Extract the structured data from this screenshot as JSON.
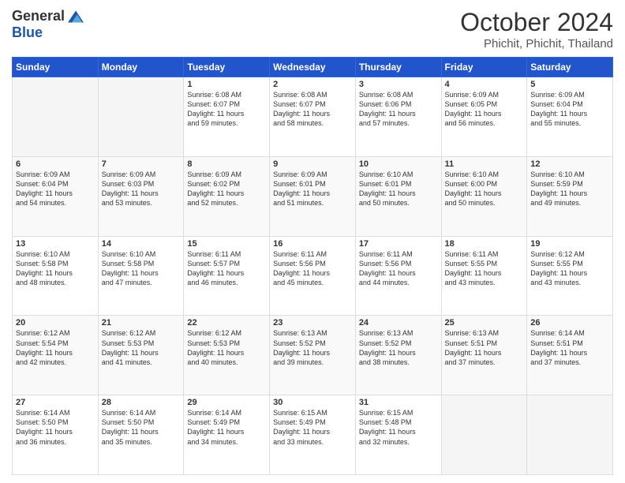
{
  "logo": {
    "general": "General",
    "blue": "Blue"
  },
  "title": "October 2024",
  "location": "Phichit, Phichit, Thailand",
  "days_of_week": [
    "Sunday",
    "Monday",
    "Tuesday",
    "Wednesday",
    "Thursday",
    "Friday",
    "Saturday"
  ],
  "weeks": [
    [
      {
        "day": "",
        "content": ""
      },
      {
        "day": "",
        "content": ""
      },
      {
        "day": "1",
        "sunrise": "6:08 AM",
        "sunset": "6:07 PM",
        "daylight": "11 hours and 59 minutes."
      },
      {
        "day": "2",
        "sunrise": "6:08 AM",
        "sunset": "6:07 PM",
        "daylight": "11 hours and 58 minutes."
      },
      {
        "day": "3",
        "sunrise": "6:08 AM",
        "sunset": "6:06 PM",
        "daylight": "11 hours and 57 minutes."
      },
      {
        "day": "4",
        "sunrise": "6:09 AM",
        "sunset": "6:05 PM",
        "daylight": "11 hours and 56 minutes."
      },
      {
        "day": "5",
        "sunrise": "6:09 AM",
        "sunset": "6:04 PM",
        "daylight": "11 hours and 55 minutes."
      }
    ],
    [
      {
        "day": "6",
        "sunrise": "6:09 AM",
        "sunset": "6:04 PM",
        "daylight": "11 hours and 54 minutes."
      },
      {
        "day": "7",
        "sunrise": "6:09 AM",
        "sunset": "6:03 PM",
        "daylight": "11 hours and 53 minutes."
      },
      {
        "day": "8",
        "sunrise": "6:09 AM",
        "sunset": "6:02 PM",
        "daylight": "11 hours and 52 minutes."
      },
      {
        "day": "9",
        "sunrise": "6:09 AM",
        "sunset": "6:01 PM",
        "daylight": "11 hours and 51 minutes."
      },
      {
        "day": "10",
        "sunrise": "6:10 AM",
        "sunset": "6:01 PM",
        "daylight": "11 hours and 50 minutes."
      },
      {
        "day": "11",
        "sunrise": "6:10 AM",
        "sunset": "6:00 PM",
        "daylight": "11 hours and 50 minutes."
      },
      {
        "day": "12",
        "sunrise": "6:10 AM",
        "sunset": "5:59 PM",
        "daylight": "11 hours and 49 minutes."
      }
    ],
    [
      {
        "day": "13",
        "sunrise": "6:10 AM",
        "sunset": "5:58 PM",
        "daylight": "11 hours and 48 minutes."
      },
      {
        "day": "14",
        "sunrise": "6:10 AM",
        "sunset": "5:58 PM",
        "daylight": "11 hours and 47 minutes."
      },
      {
        "day": "15",
        "sunrise": "6:11 AM",
        "sunset": "5:57 PM",
        "daylight": "11 hours and 46 minutes."
      },
      {
        "day": "16",
        "sunrise": "6:11 AM",
        "sunset": "5:56 PM",
        "daylight": "11 hours and 45 minutes."
      },
      {
        "day": "17",
        "sunrise": "6:11 AM",
        "sunset": "5:56 PM",
        "daylight": "11 hours and 44 minutes."
      },
      {
        "day": "18",
        "sunrise": "6:11 AM",
        "sunset": "5:55 PM",
        "daylight": "11 hours and 43 minutes."
      },
      {
        "day": "19",
        "sunrise": "6:12 AM",
        "sunset": "5:55 PM",
        "daylight": "11 hours and 43 minutes."
      }
    ],
    [
      {
        "day": "20",
        "sunrise": "6:12 AM",
        "sunset": "5:54 PM",
        "daylight": "11 hours and 42 minutes."
      },
      {
        "day": "21",
        "sunrise": "6:12 AM",
        "sunset": "5:53 PM",
        "daylight": "11 hours and 41 minutes."
      },
      {
        "day": "22",
        "sunrise": "6:12 AM",
        "sunset": "5:53 PM",
        "daylight": "11 hours and 40 minutes."
      },
      {
        "day": "23",
        "sunrise": "6:13 AM",
        "sunset": "5:52 PM",
        "daylight": "11 hours and 39 minutes."
      },
      {
        "day": "24",
        "sunrise": "6:13 AM",
        "sunset": "5:52 PM",
        "daylight": "11 hours and 38 minutes."
      },
      {
        "day": "25",
        "sunrise": "6:13 AM",
        "sunset": "5:51 PM",
        "daylight": "11 hours and 37 minutes."
      },
      {
        "day": "26",
        "sunrise": "6:14 AM",
        "sunset": "5:51 PM",
        "daylight": "11 hours and 37 minutes."
      }
    ],
    [
      {
        "day": "27",
        "sunrise": "6:14 AM",
        "sunset": "5:50 PM",
        "daylight": "11 hours and 36 minutes."
      },
      {
        "day": "28",
        "sunrise": "6:14 AM",
        "sunset": "5:50 PM",
        "daylight": "11 hours and 35 minutes."
      },
      {
        "day": "29",
        "sunrise": "6:14 AM",
        "sunset": "5:49 PM",
        "daylight": "11 hours and 34 minutes."
      },
      {
        "day": "30",
        "sunrise": "6:15 AM",
        "sunset": "5:49 PM",
        "daylight": "11 hours and 33 minutes."
      },
      {
        "day": "31",
        "sunrise": "6:15 AM",
        "sunset": "5:48 PM",
        "daylight": "11 hours and 32 minutes."
      },
      {
        "day": "",
        "content": ""
      },
      {
        "day": "",
        "content": ""
      }
    ]
  ],
  "labels": {
    "sunrise": "Sunrise:",
    "sunset": "Sunset:",
    "daylight": "Daylight:"
  }
}
